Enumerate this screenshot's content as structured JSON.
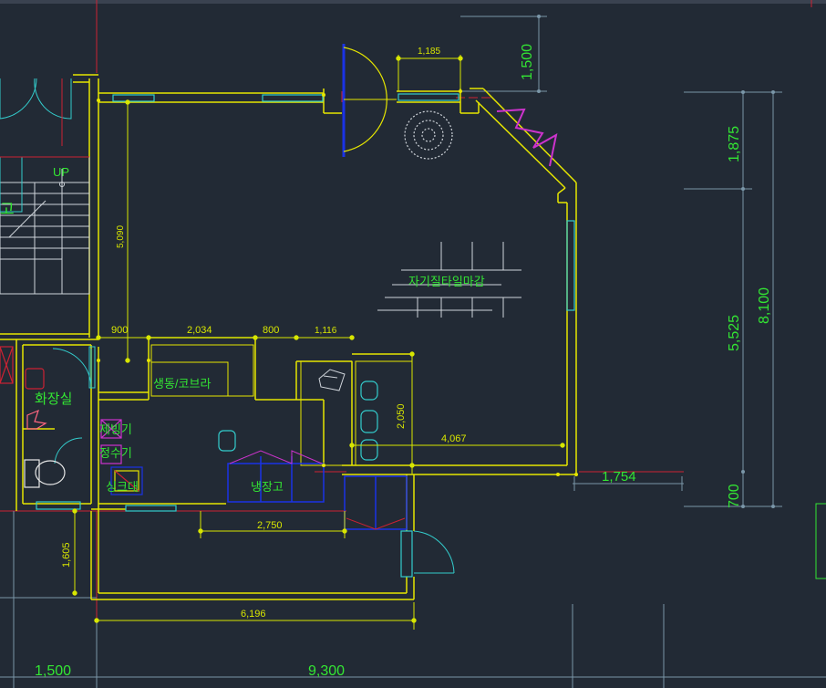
{
  "colors": {
    "background": "#222a35",
    "wall": "#e6e600",
    "dimension": "#d8e600",
    "dim_ext": "#7a96a8",
    "green_text": "#33e633",
    "cyan": "#33cccc",
    "blue": "#1a33e6",
    "red": "#cc2233",
    "magenta": "#cc33cc",
    "pink": "#ff6680",
    "white": "#e8e8e8"
  },
  "rooms": {
    "stair_up": "UP",
    "stair_room": "고",
    "restroom": "화장실",
    "tile_finish": "자기질타일마감",
    "drink_cooler": "생동/코브라",
    "ice_maker": "제빙기",
    "water_purifier": "정수기",
    "sink": "싱크대",
    "refrigerator": "냉장고"
  },
  "dimensions": {
    "door_width": "1,185",
    "top_right": "1,500",
    "right_top": "1,875",
    "right_middle": "5,525",
    "right_total": "8,100",
    "right_bottom": "700",
    "left_height": "5,090",
    "seg_900": "900",
    "seg_2034": "2,034",
    "seg_800": "800",
    "seg_1116": "1,116",
    "counter_height": "2,050",
    "counter_width": "4,067",
    "outside_1754": "1,754",
    "front_width": "2,750",
    "left_lower": "1,605",
    "total_width": "6,196",
    "bottom_left": "1,500",
    "bottom_total": "9,300"
  }
}
